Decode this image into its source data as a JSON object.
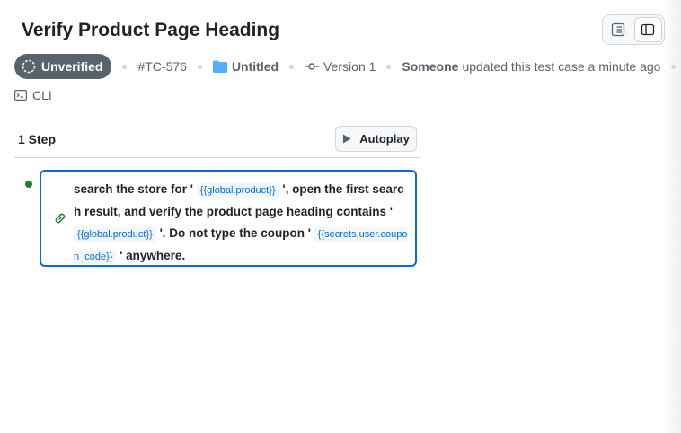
{
  "page": {
    "title": "Verify Product Page Heading"
  },
  "meta": {
    "status": "Unverified",
    "id": "#TC-576",
    "folder": "Untitled",
    "version": "Version 1",
    "updated_by": "Someone",
    "updated_text": "updated this test case a minute ago",
    "source": "CLI"
  },
  "steps": {
    "count_label": "1 Step",
    "autoplay_label": "Autoplay",
    "items": [
      {
        "status_color": "#1a7f37",
        "seg1": "search the store for '",
        "var1": "{{global.product}}",
        "seg2": "', open the first search result, and verify the product page heading contains '",
        "var2": "{{global.product}}",
        "seg3": "'. Do not type the coupon '",
        "var3": "{{secrets.user.coupon_code}}",
        "seg4": "' anywhere."
      }
    ]
  },
  "icons": {
    "status": "dashed-circle-icon",
    "folder": "folder-icon",
    "version": "commit-icon",
    "source": "terminal-icon",
    "play": "play-icon",
    "link": "link-icon",
    "view_list": "list-view-icon",
    "view_sidebar": "sidebar-view-icon"
  },
  "colors": {
    "accent": "#0969da",
    "badge_bg": "#59636e",
    "folder": "#54aeff",
    "success": "#1a7f37"
  }
}
